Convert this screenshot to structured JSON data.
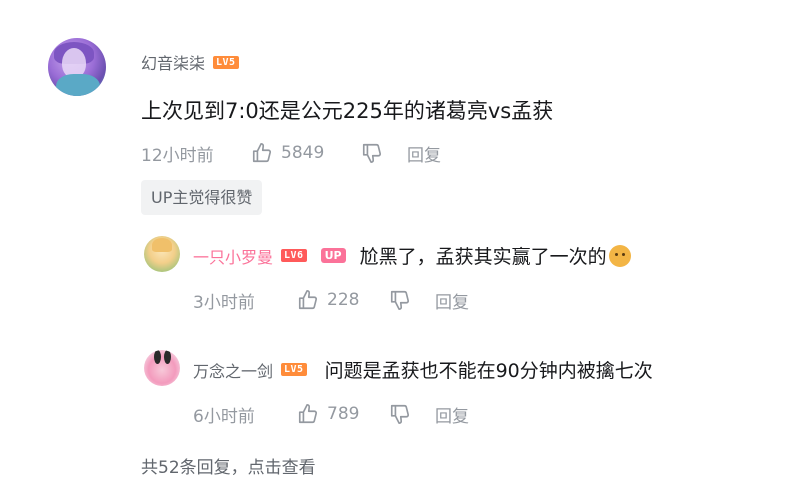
{
  "comment": {
    "username": "幻音柒柒",
    "level": "LV5",
    "content": "上次见到7:0还是公元225年的诸葛亮vs孟获",
    "time": "12小时前",
    "likes": "5849",
    "reply_label": "回复",
    "up_tag": "UP主觉得很赞",
    "avatar_icon": "anime-girl-avatar"
  },
  "replies": [
    {
      "username": "一只小罗曼",
      "level": "LV6",
      "up_badge": "UP",
      "content": "尬黑了，孟获其实赢了一次的",
      "emoji": "doge-emoji",
      "time": "3小时前",
      "likes": "228",
      "reply_label": "回复"
    },
    {
      "username": "万念之一剑",
      "level": "LV5",
      "content": "问题是孟获也不能在90分钟内被擒七次",
      "time": "6小时前",
      "likes": "789",
      "reply_label": "回复"
    }
  ],
  "more_replies": "共52条回复，点击查看",
  "colors": {
    "text": "#18191c",
    "meta": "#9499a0",
    "up_pink": "#fb7299",
    "lv5": "#ff8c3a",
    "lv6": "#ff5a5a"
  }
}
